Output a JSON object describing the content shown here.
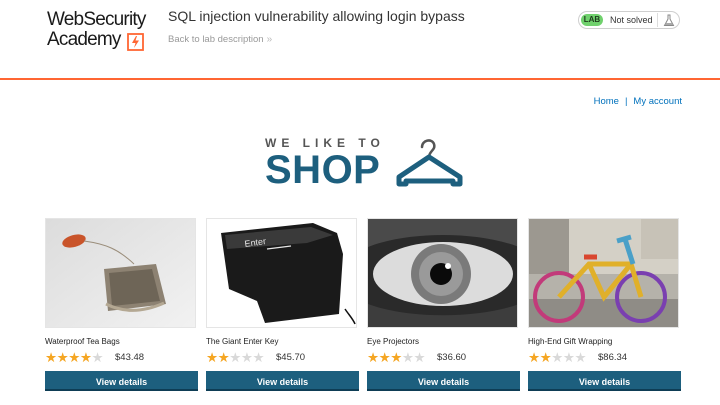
{
  "header": {
    "logo_line1": "WebSecurity",
    "logo_line2": "Academy",
    "lab_title": "SQL injection vulnerability allowing login bypass",
    "back_link": "Back to lab description",
    "back_chevron": "»",
    "lab_badge": "LAB",
    "lab_status": "Not solved",
    "accent_color": "#ff6633",
    "badge_color": "#70d16d"
  },
  "nav": {
    "home": "Home",
    "separator": "|",
    "my_account": "My account",
    "link_color": "#0071bc"
  },
  "banner": {
    "small_text": "WE LIKE TO",
    "big_text": "SHOP",
    "icon": "hanger-icon",
    "color": "#1d5f7e"
  },
  "products": [
    {
      "name": "Waterproof Tea Bags",
      "rating": 4,
      "price": "$43.48",
      "button": "View details",
      "image": "tea-bag-image"
    },
    {
      "name": "The Giant Enter Key",
      "rating": 2,
      "price": "$45.70",
      "button": "View details",
      "image": "enter-key-image"
    },
    {
      "name": "Eye Projectors",
      "rating": 3,
      "price": "$36.60",
      "button": "View details",
      "image": "eye-image"
    },
    {
      "name": "High-End Gift Wrapping",
      "rating": 2,
      "price": "$86.34",
      "button": "View details",
      "image": "wrapped-bicycle-image"
    }
  ],
  "rating_max": 5,
  "button_color": "#1d5f7e"
}
